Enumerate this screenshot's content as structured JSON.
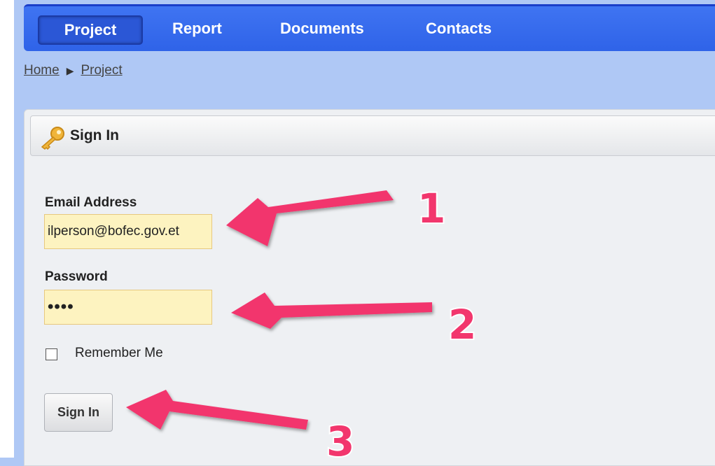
{
  "nav": {
    "items": [
      {
        "label": "Project",
        "active": true
      },
      {
        "label": "Report",
        "active": false
      },
      {
        "label": "Documents",
        "active": false
      },
      {
        "label": "Contacts",
        "active": false
      }
    ]
  },
  "breadcrumb": {
    "home": "Home",
    "current": "Project"
  },
  "signin_panel": {
    "title": "Sign In",
    "email_label": "Email Address",
    "email_value": "ilperson@bofec.gov.et",
    "password_label": "Password",
    "password_value": "••••",
    "remember_label": "Remember Me",
    "remember_checked": false,
    "submit_label": "Sign In"
  },
  "annotations": {
    "arrow_color": "#f2366d",
    "steps": [
      "1",
      "2",
      "3"
    ]
  },
  "colors": {
    "nav_bg": "#3a6ff0",
    "page_bg": "#afc8f5",
    "input_bg": "#fdf3c0"
  },
  "icons": {
    "panel_header": "key-icon"
  }
}
